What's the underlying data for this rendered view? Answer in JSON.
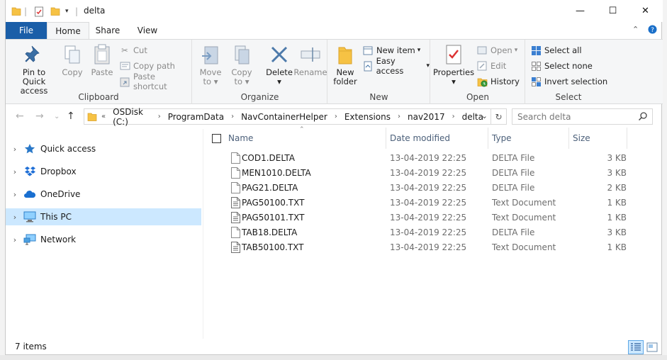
{
  "window": {
    "title": "delta",
    "controls": {
      "minimize": "—",
      "maximize": "☐",
      "close": "✕"
    }
  },
  "ribbon_tabs": {
    "file": "File",
    "home": "Home",
    "share": "Share",
    "view": "View"
  },
  "ribbon": {
    "clipboard": {
      "label": "Clipboard",
      "pin_line1": "Pin to Quick",
      "pin_line2": "access",
      "copy": "Copy",
      "paste": "Paste",
      "cut": "Cut",
      "copy_path": "Copy path",
      "paste_shortcut": "Paste shortcut"
    },
    "organize": {
      "label": "Organize",
      "move_to_line1": "Move",
      "move_to_line2": "to",
      "copy_to_line1": "Copy",
      "copy_to_line2": "to",
      "delete": "Delete",
      "rename": "Rename"
    },
    "new": {
      "label": "New",
      "new_folder_line1": "New",
      "new_folder_line2": "folder",
      "new_item": "New item",
      "easy_access": "Easy access"
    },
    "open": {
      "label": "Open",
      "properties": "Properties",
      "open": "Open",
      "edit": "Edit",
      "history": "History"
    },
    "select": {
      "label": "Select",
      "select_all": "Select all",
      "select_none": "Select none",
      "invert_selection": "Invert selection"
    }
  },
  "address": {
    "overflow": "«",
    "crumbs": [
      "OSDisk (C:)",
      "ProgramData",
      "NavContainerHelper",
      "Extensions",
      "nav2017",
      "delta"
    ],
    "search_placeholder": "Search delta"
  },
  "nav_pane": {
    "items": [
      {
        "label": "Quick access",
        "icon": "star-icon"
      },
      {
        "label": "Dropbox",
        "icon": "dropbox-icon"
      },
      {
        "label": "OneDrive",
        "icon": "onedrive-icon"
      },
      {
        "label": "This PC",
        "icon": "this-pc-icon",
        "selected": true
      },
      {
        "label": "Network",
        "icon": "network-icon"
      }
    ]
  },
  "file_list": {
    "columns": {
      "name": "Name",
      "date": "Date modified",
      "type": "Type",
      "size": "Size"
    },
    "rows": [
      {
        "name": "COD1.DELTA",
        "date": "13-04-2019 22:25",
        "type": "DELTA File",
        "size": "3 KB"
      },
      {
        "name": "MEN1010.DELTA",
        "date": "13-04-2019 22:25",
        "type": "DELTA File",
        "size": "3 KB"
      },
      {
        "name": "PAG21.DELTA",
        "date": "13-04-2019 22:25",
        "type": "DELTA File",
        "size": "2 KB"
      },
      {
        "name": "PAG50100.TXT",
        "date": "13-04-2019 22:25",
        "type": "Text Document",
        "size": "1 KB"
      },
      {
        "name": "PAG50101.TXT",
        "date": "13-04-2019 22:25",
        "type": "Text Document",
        "size": "1 KB"
      },
      {
        "name": "TAB18.DELTA",
        "date": "13-04-2019 22:25",
        "type": "DELTA File",
        "size": "3 KB"
      },
      {
        "name": "TAB50100.TXT",
        "date": "13-04-2019 22:25",
        "type": "Text Document",
        "size": "1 KB"
      }
    ]
  },
  "status": {
    "item_count": "7 items"
  },
  "colors": {
    "file_tab": "#1a5ea8",
    "selection": "#cce8ff",
    "folder": "#f6c244",
    "header_text": "#4c607a"
  }
}
